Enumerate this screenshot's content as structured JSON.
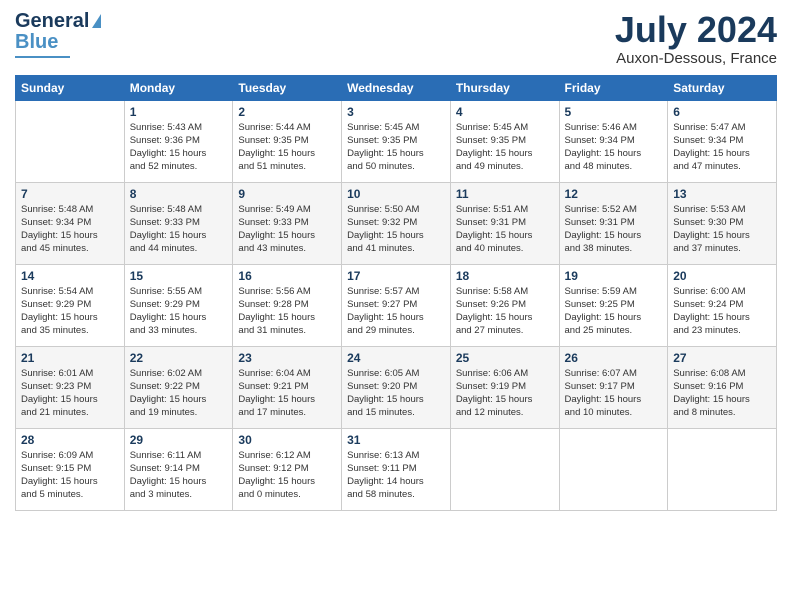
{
  "logo": {
    "line1": "General",
    "line2": "Blue"
  },
  "title": "July 2024",
  "location": "Auxon-Dessous, France",
  "days_of_week": [
    "Sunday",
    "Monday",
    "Tuesday",
    "Wednesday",
    "Thursday",
    "Friday",
    "Saturday"
  ],
  "weeks": [
    [
      {
        "day": "",
        "info": ""
      },
      {
        "day": "1",
        "info": "Sunrise: 5:43 AM\nSunset: 9:36 PM\nDaylight: 15 hours\nand 52 minutes."
      },
      {
        "day": "2",
        "info": "Sunrise: 5:44 AM\nSunset: 9:35 PM\nDaylight: 15 hours\nand 51 minutes."
      },
      {
        "day": "3",
        "info": "Sunrise: 5:45 AM\nSunset: 9:35 PM\nDaylight: 15 hours\nand 50 minutes."
      },
      {
        "day": "4",
        "info": "Sunrise: 5:45 AM\nSunset: 9:35 PM\nDaylight: 15 hours\nand 49 minutes."
      },
      {
        "day": "5",
        "info": "Sunrise: 5:46 AM\nSunset: 9:34 PM\nDaylight: 15 hours\nand 48 minutes."
      },
      {
        "day": "6",
        "info": "Sunrise: 5:47 AM\nSunset: 9:34 PM\nDaylight: 15 hours\nand 47 minutes."
      }
    ],
    [
      {
        "day": "7",
        "info": "Sunrise: 5:48 AM\nSunset: 9:34 PM\nDaylight: 15 hours\nand 45 minutes."
      },
      {
        "day": "8",
        "info": "Sunrise: 5:48 AM\nSunset: 9:33 PM\nDaylight: 15 hours\nand 44 minutes."
      },
      {
        "day": "9",
        "info": "Sunrise: 5:49 AM\nSunset: 9:33 PM\nDaylight: 15 hours\nand 43 minutes."
      },
      {
        "day": "10",
        "info": "Sunrise: 5:50 AM\nSunset: 9:32 PM\nDaylight: 15 hours\nand 41 minutes."
      },
      {
        "day": "11",
        "info": "Sunrise: 5:51 AM\nSunset: 9:31 PM\nDaylight: 15 hours\nand 40 minutes."
      },
      {
        "day": "12",
        "info": "Sunrise: 5:52 AM\nSunset: 9:31 PM\nDaylight: 15 hours\nand 38 minutes."
      },
      {
        "day": "13",
        "info": "Sunrise: 5:53 AM\nSunset: 9:30 PM\nDaylight: 15 hours\nand 37 minutes."
      }
    ],
    [
      {
        "day": "14",
        "info": "Sunrise: 5:54 AM\nSunset: 9:29 PM\nDaylight: 15 hours\nand 35 minutes."
      },
      {
        "day": "15",
        "info": "Sunrise: 5:55 AM\nSunset: 9:29 PM\nDaylight: 15 hours\nand 33 minutes."
      },
      {
        "day": "16",
        "info": "Sunrise: 5:56 AM\nSunset: 9:28 PM\nDaylight: 15 hours\nand 31 minutes."
      },
      {
        "day": "17",
        "info": "Sunrise: 5:57 AM\nSunset: 9:27 PM\nDaylight: 15 hours\nand 29 minutes."
      },
      {
        "day": "18",
        "info": "Sunrise: 5:58 AM\nSunset: 9:26 PM\nDaylight: 15 hours\nand 27 minutes."
      },
      {
        "day": "19",
        "info": "Sunrise: 5:59 AM\nSunset: 9:25 PM\nDaylight: 15 hours\nand 25 minutes."
      },
      {
        "day": "20",
        "info": "Sunrise: 6:00 AM\nSunset: 9:24 PM\nDaylight: 15 hours\nand 23 minutes."
      }
    ],
    [
      {
        "day": "21",
        "info": "Sunrise: 6:01 AM\nSunset: 9:23 PM\nDaylight: 15 hours\nand 21 minutes."
      },
      {
        "day": "22",
        "info": "Sunrise: 6:02 AM\nSunset: 9:22 PM\nDaylight: 15 hours\nand 19 minutes."
      },
      {
        "day": "23",
        "info": "Sunrise: 6:04 AM\nSunset: 9:21 PM\nDaylight: 15 hours\nand 17 minutes."
      },
      {
        "day": "24",
        "info": "Sunrise: 6:05 AM\nSunset: 9:20 PM\nDaylight: 15 hours\nand 15 minutes."
      },
      {
        "day": "25",
        "info": "Sunrise: 6:06 AM\nSunset: 9:19 PM\nDaylight: 15 hours\nand 12 minutes."
      },
      {
        "day": "26",
        "info": "Sunrise: 6:07 AM\nSunset: 9:17 PM\nDaylight: 15 hours\nand 10 minutes."
      },
      {
        "day": "27",
        "info": "Sunrise: 6:08 AM\nSunset: 9:16 PM\nDaylight: 15 hours\nand 8 minutes."
      }
    ],
    [
      {
        "day": "28",
        "info": "Sunrise: 6:09 AM\nSunset: 9:15 PM\nDaylight: 15 hours\nand 5 minutes."
      },
      {
        "day": "29",
        "info": "Sunrise: 6:11 AM\nSunset: 9:14 PM\nDaylight: 15 hours\nand 3 minutes."
      },
      {
        "day": "30",
        "info": "Sunrise: 6:12 AM\nSunset: 9:12 PM\nDaylight: 15 hours\nand 0 minutes."
      },
      {
        "day": "31",
        "info": "Sunrise: 6:13 AM\nSunset: 9:11 PM\nDaylight: 14 hours\nand 58 minutes."
      },
      {
        "day": "",
        "info": ""
      },
      {
        "day": "",
        "info": ""
      },
      {
        "day": "",
        "info": ""
      }
    ]
  ]
}
